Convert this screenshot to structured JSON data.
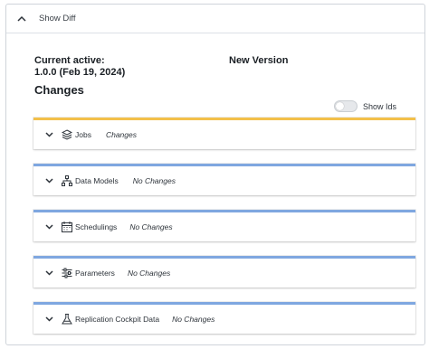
{
  "header": {
    "toggle_label": "Show Diff"
  },
  "versions": {
    "current_label": "Current active:",
    "current_value": "1.0.0 (Feb 19, 2024)",
    "new_label": "New Version"
  },
  "changes": {
    "title": "Changes",
    "show_ids_label": "Show Ids",
    "show_ids_on": false
  },
  "sections": [
    {
      "title": "Jobs",
      "status": "Changes",
      "icon": "layers-icon",
      "accent": "#f3c04a"
    },
    {
      "title": "Data Models",
      "status": "No Changes",
      "icon": "hierarchy-icon",
      "accent": "#7fa7e0"
    },
    {
      "title": "Schedulings",
      "status": "No Changes",
      "icon": "calendar-icon",
      "accent": "#7fa7e0"
    },
    {
      "title": "Parameters",
      "status": "No Changes",
      "icon": "sliders-icon",
      "accent": "#7fa7e0"
    },
    {
      "title": "Replication Cockpit Data",
      "status": "No Changes",
      "icon": "flask-icon",
      "accent": "#7fa7e0"
    }
  ]
}
